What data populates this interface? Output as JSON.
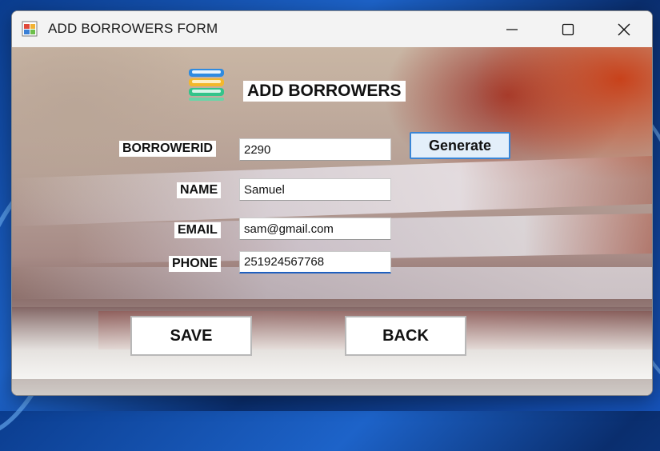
{
  "window": {
    "title": "ADD BORROWERS FORM",
    "app_icon": "form-app-icon",
    "controls": [
      "minimize-icon",
      "maximize-icon",
      "close-icon"
    ]
  },
  "form": {
    "logo_icon": "books-stack-icon",
    "header": "ADD BORROWERS",
    "borrowerid_label": "BORROWERID",
    "borrowerid_value": "2290",
    "generate_label": "Generate",
    "name_label": "NAME",
    "name_value": "Samuel",
    "email_label": "EMAIL",
    "email_value": "sam@gmail.com",
    "phone_label": "PHONE",
    "phone_value": "251924567768",
    "save_label": "SAVE",
    "back_label": "BACK"
  },
  "colors": {
    "focus_underline": "#1e5fbf",
    "generate_border": "#3a86d6",
    "generate_bg": "#e3effa"
  }
}
